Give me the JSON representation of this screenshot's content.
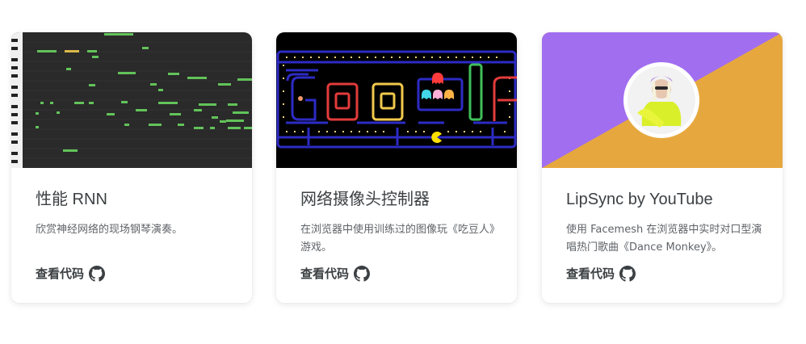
{
  "cards": [
    {
      "title": "性能 RNN",
      "description": "欣赏神经网络的现场钢琴演奏。",
      "link_label": "查看代码",
      "link_icon": "github-icon",
      "thumbnail": "piano-roll"
    },
    {
      "title": "网络摄像头控制器",
      "description": "在浏览器中使用训练过的图像玩《吃豆人》游戏。",
      "link_label": "查看代码",
      "link_icon": "github-icon",
      "thumbnail": "pacman-google-doodle"
    },
    {
      "title": "LipSync by YouTube",
      "description": "使用 Facemesh 在浏览器中实时对口型演唱热门歌曲《Dance Monkey》。",
      "link_label": "查看代码",
      "link_icon": "github-icon",
      "thumbnail": "lipsync-avatar"
    }
  ],
  "colors": {
    "title": "#3c4043",
    "description": "#5f6368",
    "lipsync_purple": "#a16ef0",
    "lipsync_orange": "#e6a83e",
    "piano_notes": "#62c35a",
    "pacman_maze": "#2d2bc4"
  }
}
